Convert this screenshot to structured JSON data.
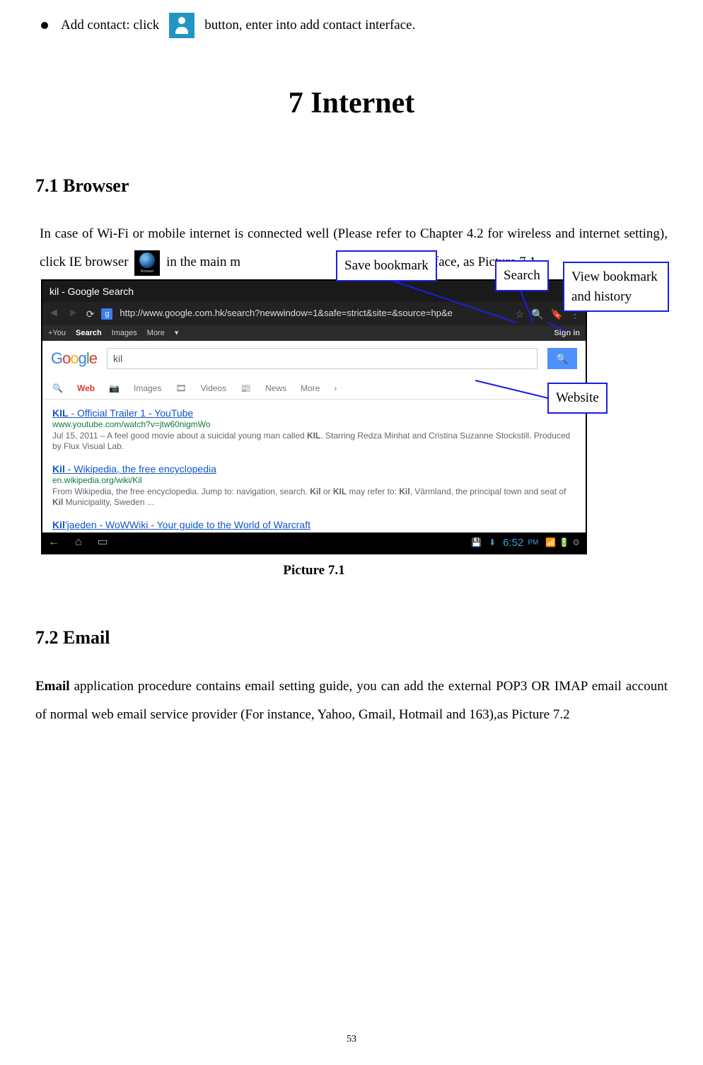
{
  "bullet": {
    "pre": "Add contact: click",
    "post": "button, enter into add contact interface."
  },
  "chapter_title": "7 Internet",
  "section_browser": "7.1 Browser",
  "para_browser_a": "In case of Wi-Fi or mobile internet is connected well (Please refer to Chapter 4.2 for wireless and internet setting), click IE browser",
  "para_browser_b": "in the main m",
  "para_browser_c": "er the IE interface, as Picture 7.1",
  "shot": {
    "title": "kil - Google Search",
    "url": "http://www.google.com.hk/search?newwindow=1&safe=strict&site=&source=hp&e",
    "gnav": {
      "items": [
        "+You",
        "Search",
        "Images",
        "More"
      ],
      "search_bold": "Search",
      "signin": "Sign in"
    },
    "query": "kil",
    "filters": [
      "Web",
      "Images",
      "Videos",
      "News",
      "More"
    ],
    "results": [
      {
        "title_pre": "KIL",
        "title_post": " - Official Trailer 1 - YouTube",
        "url": "www.youtube.com/watch?v=jtw60nigmWo",
        "desc_pre": "Jul 15, 2011 – A feel good movie about a suicidal young man called ",
        "desc_b1": "KIL",
        "desc_mid": ". Starring Redza Minhat and Cristina Suzanne Stockstill. Produced by Flux Visual Lab."
      },
      {
        "title_pre": "Kil",
        "title_post": " - Wikipedia, the free encyclopedia",
        "url": "en.wikipedia.org/wiki/Kil",
        "desc_pre": "From Wikipedia, the free encyclopedia. Jump to: navigation, search. ",
        "desc_b1": "Kil",
        "desc_mid": " or ",
        "desc_b2": "KIL",
        "desc_mid2": " may refer to: ",
        "desc_b3": "Kil",
        "desc_mid3": ", Värmland, the principal town and seat of ",
        "desc_b4": "Kil",
        "desc_post": " Municipality, Sweden ..."
      },
      {
        "title_pre": "Kil",
        "title_post": "'jaeden - WoWWiki - Your guide to the World of Warcraft"
      }
    ],
    "clock": "6:52",
    "ampm": "PM"
  },
  "caption": "Picture 7.1",
  "callouts": {
    "save_bookmark": "Save bookmark",
    "search": "Search",
    "view_bookmark": "View bookmark and history",
    "website": "Website"
  },
  "section_email": "7.2 Email",
  "para_email_a": "Email",
  "para_email_b": " application procedure contains email setting guide, you can add the external POP3 OR IMAP email account of normal web email service provider (For instance, Yahoo, Gmail, Hotmail and 163),as Picture 7.2",
  "page_number": "53"
}
